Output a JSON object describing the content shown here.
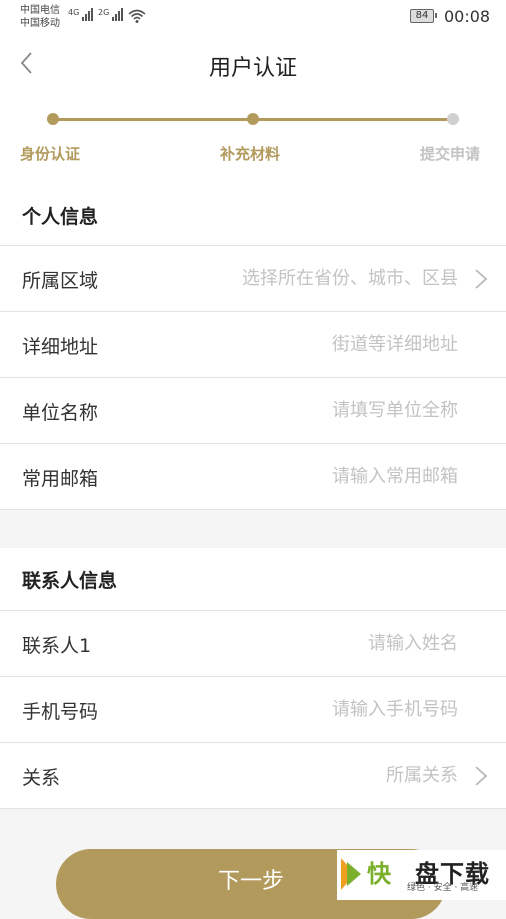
{
  "status_bar": {
    "carrier_1": "中国电信",
    "carrier_2": "中国移动",
    "network_1": "4G",
    "network_2": "2G",
    "battery": "84",
    "time": "00:08",
    "icons": [
      "signal-icon",
      "wifi-icon",
      "battery-icon"
    ]
  },
  "header": {
    "title": "用户认证",
    "back_icon": "chevron-left-icon"
  },
  "stepper": {
    "steps": [
      {
        "label": "身份认证",
        "state": "done"
      },
      {
        "label": "补充材料",
        "state": "current"
      },
      {
        "label": "提交申请",
        "state": "pending"
      }
    ],
    "active_color": "#b29a5d",
    "inactive_color": "#c8c8c8"
  },
  "personal_section": {
    "title": "个人信息",
    "rows": [
      {
        "label": "所属区域",
        "placeholder": "选择所在省份、城市、区县",
        "has_chevron": true
      },
      {
        "label": "详细地址",
        "placeholder": "街道等详细地址",
        "has_chevron": false
      },
      {
        "label": "单位名称",
        "placeholder": "请填写单位全称",
        "has_chevron": false
      },
      {
        "label": "常用邮箱",
        "placeholder": "请输入常用邮箱",
        "has_chevron": false
      }
    ]
  },
  "contact_section": {
    "title": "联系人信息",
    "rows": [
      {
        "label": "联系人1",
        "placeholder": "请输入姓名",
        "has_chevron": false
      },
      {
        "label": "手机号码",
        "placeholder": "请输入手机号码",
        "has_chevron": false
      },
      {
        "label": "关系",
        "placeholder": "所属关系",
        "has_chevron": true
      }
    ]
  },
  "footer": {
    "next_label": "下一步",
    "button_color": "#b29a5d"
  },
  "watermark": {
    "brand_1": "快",
    "brand_2": "盘下载",
    "tagline": "绿色 · 安全 · 高速"
  }
}
